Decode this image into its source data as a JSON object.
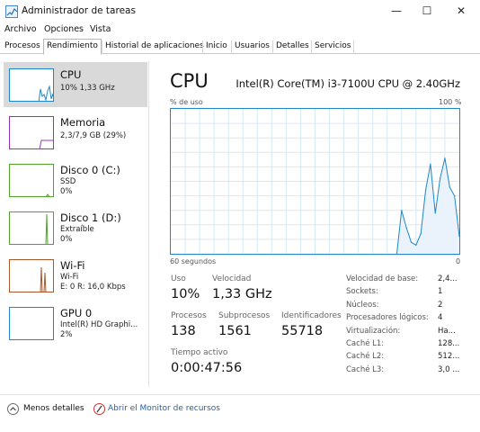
{
  "window": {
    "title": "Administrador de tareas",
    "controls": {
      "minimize": "—",
      "maximize": "☐",
      "close": "✕"
    }
  },
  "menu": [
    "Archivo",
    "Opciones",
    "Vista"
  ],
  "tabs": [
    "Procesos",
    "Rendimiento",
    "Historial de aplicaciones",
    "Inicio",
    "Usuarios",
    "Detalles",
    "Servicios"
  ],
  "active_tab": "Rendimiento",
  "sidebar": [
    {
      "title": "CPU",
      "sub1": "10% 1,33 GHz",
      "sub2": "",
      "color": "#1e87c9"
    },
    {
      "title": "Memoria",
      "sub1": "2,3/7,9 GB (29%)",
      "sub2": "",
      "color": "#9c31b9"
    },
    {
      "title": "Disco 0 (C:)",
      "sub1": "SSD",
      "sub2": "0%",
      "color": "#4fa429"
    },
    {
      "title": "Disco 1 (D:)",
      "sub1": "Extraíble",
      "sub2": "0%",
      "color": "#4fa429"
    },
    {
      "title": "Wi-Fi",
      "sub1": "Wi-Fi",
      "sub2": "E: 0 R: 16,0 Kbps",
      "color": "#a8582a"
    },
    {
      "title": "GPU 0",
      "sub1": "Intel(R) HD Graphi...",
      "sub2": "2%",
      "color": "#1e87c9"
    }
  ],
  "main": {
    "title": "CPU",
    "model": "Intel(R) Core(TM) i3-7100U CPU @ 2.40GHz",
    "graph_top_left": "% de uso",
    "graph_top_right": "100 %",
    "graph_bottom_left": "60 segundos",
    "graph_bottom_right": "0",
    "stats": {
      "uso_label": "Uso",
      "uso_value": "10%",
      "velocidad_label": "Velocidad",
      "velocidad_value": "1,33 GHz",
      "procesos_label": "Procesos",
      "procesos_value": "138",
      "subprocesos_label": "Subprocesos",
      "subprocesos_value": "1561",
      "identificadores_label": "Identificadores",
      "identificadores_value": "55718",
      "tiempo_label": "Tiempo activo",
      "tiempo_value": "0:00:47:56"
    },
    "specs": [
      {
        "label": "Velocidad de base:",
        "value": "2,4..."
      },
      {
        "label": "Sockets:",
        "value": "1"
      },
      {
        "label": "Núcleos:",
        "value": "2"
      },
      {
        "label": "Procesadores lógicos:",
        "value": "4"
      },
      {
        "label": "Virtualización:",
        "value": "Ha..."
      },
      {
        "label": "Caché L1:",
        "value": "128..."
      },
      {
        "label": "Caché L2:",
        "value": "512..."
      },
      {
        "label": "Caché L3:",
        "value": "3,0 ..."
      }
    ]
  },
  "footer": {
    "less_details": "Menos detalles",
    "resource_monitor": "Abrir el Monitor de recursos"
  },
  "chart_data": {
    "type": "area",
    "title": "",
    "xlabel": "60 segundos",
    "ylabel": "% de uso",
    "ylim": [
      0,
      100
    ],
    "xlim": [
      60,
      0
    ],
    "grid": true,
    "series": [
      {
        "x": [
          13,
          12,
          11,
          10,
          9,
          8,
          7,
          6,
          5,
          4,
          3,
          2,
          1,
          0
        ],
        "values": [
          0,
          30,
          18,
          8,
          6,
          14,
          44,
          62,
          28,
          52,
          66,
          46,
          40,
          12
        ]
      }
    ]
  }
}
